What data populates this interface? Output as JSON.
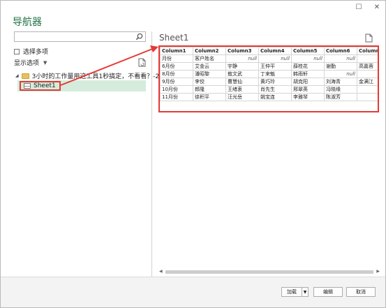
{
  "window": {
    "title": "导航器",
    "controls": {
      "restore": "☐",
      "close": "✕"
    }
  },
  "left": {
    "search_placeholder": "",
    "multi_select_label": "选择多项",
    "display_options_label": "显示选项",
    "tree_root_label": "3小时的工作量用这工具1秒搞定，不看看？-2...",
    "tree_child_label": "Sheet1"
  },
  "preview": {
    "title": "Sheet1",
    "headers": [
      "Column1",
      "Column2",
      "Column3",
      "Column4",
      "Column5",
      "Column6",
      "Column"
    ],
    "rows": [
      [
        "月份",
        "客户姓名",
        "null",
        "null",
        "null",
        "null",
        ""
      ],
      [
        "6月份",
        "艾金云",
        "宇静",
        "王仲平",
        "薛桂花",
        "谢勤",
        "高嘉蓉"
      ],
      [
        "8月份",
        "潘昭黎",
        "敖文武",
        "丁来魁",
        "韩雨轩",
        "null",
        ""
      ],
      [
        "9月份",
        "李佼",
        "曹慧仙",
        "黄巧玲",
        "胡克阳",
        "刘海青",
        "金满江"
      ],
      [
        "10月份",
        "郎隆",
        "王绪衷",
        "肖先生",
        "邢翠英",
        "冯晓缘",
        ""
      ],
      [
        "11月份",
        "徐积平",
        "汪光岳",
        "姚宝连",
        "李雅琴",
        "陈淑芳",
        ""
      ]
    ]
  },
  "footer": {
    "load_label": "加载",
    "edit_label": "编辑",
    "cancel_label": "取消"
  },
  "colors": {
    "accent": "#217346",
    "highlight": "#e53935",
    "selection": "#d5ecdc"
  }
}
